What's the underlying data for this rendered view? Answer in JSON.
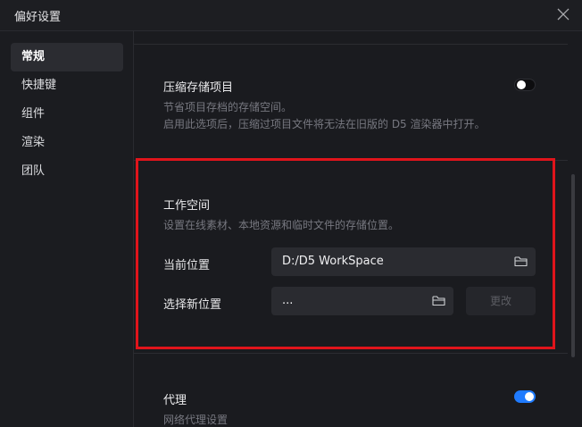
{
  "window": {
    "title": "偏好设置"
  },
  "sidebar": {
    "items": [
      {
        "label": "常规",
        "active": true
      },
      {
        "label": "快捷键",
        "active": false
      },
      {
        "label": "组件",
        "active": false
      },
      {
        "label": "渲染",
        "active": false
      },
      {
        "label": "团队",
        "active": false
      }
    ]
  },
  "sections": {
    "compress": {
      "title": "压缩存储项目",
      "desc1": "节省项目存档的存储空间。",
      "desc2": "启用此选项后，压缩过项目文件将无法在旧版的 D5 渲染器中打开。",
      "enabled": false
    },
    "workspace": {
      "title": "工作空间",
      "desc": "设置在线素材、本地资源和临时文件的存储位置。",
      "current_label": "当前位置",
      "current_value": "D:/D5 WorkSpace",
      "new_label": "选择新位置",
      "new_value": "...",
      "change_button": "更改"
    },
    "proxy": {
      "title": "代理",
      "desc": "网络代理设置",
      "enabled": true
    }
  },
  "colors": {
    "accent": "#1f7bff",
    "highlight_border": "#e0141b",
    "background": "#1a1b1f"
  }
}
